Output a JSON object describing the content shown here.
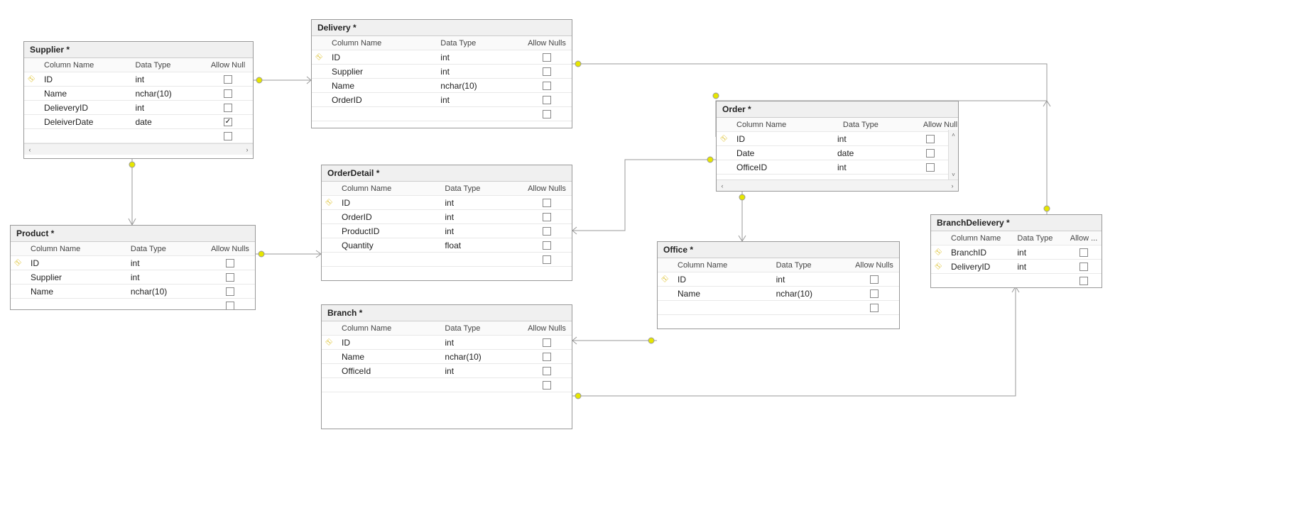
{
  "headers": {
    "colname": "Column Name",
    "datatype": "Data Type",
    "allownulls": "Allow Nulls",
    "allownull": "Allow Null",
    "allowdots": "Allow ..."
  },
  "tables": {
    "supplier": {
      "title": "Supplier *",
      "cols": [
        {
          "name": "ID",
          "type": "int",
          "key": true,
          "null": false
        },
        {
          "name": "Name",
          "type": "nchar(10)",
          "key": false,
          "null": false
        },
        {
          "name": "DelieveryID",
          "type": "int",
          "key": false,
          "null": false
        },
        {
          "name": "DeleiverDate",
          "type": "date",
          "key": false,
          "null": true
        }
      ]
    },
    "delivery": {
      "title": "Delivery *",
      "cols": [
        {
          "name": "ID",
          "type": "int",
          "key": true,
          "null": false
        },
        {
          "name": "Supplier",
          "type": "int",
          "key": false,
          "null": false
        },
        {
          "name": "Name",
          "type": "nchar(10)",
          "key": false,
          "null": false
        },
        {
          "name": "OrderID",
          "type": "int",
          "key": false,
          "null": false
        }
      ]
    },
    "product": {
      "title": "Product *",
      "cols": [
        {
          "name": "ID",
          "type": "int",
          "key": true,
          "null": false
        },
        {
          "name": "Supplier",
          "type": "int",
          "key": false,
          "null": false
        },
        {
          "name": "Name",
          "type": "nchar(10)",
          "key": false,
          "null": false
        }
      ]
    },
    "orderdetail": {
      "title": "OrderDetail *",
      "cols": [
        {
          "name": "ID",
          "type": "int",
          "key": true,
          "null": false
        },
        {
          "name": "OrderID",
          "type": "int",
          "key": false,
          "null": false
        },
        {
          "name": "ProductID",
          "type": "int",
          "key": false,
          "null": false
        },
        {
          "name": "Quantity",
          "type": "float",
          "key": false,
          "null": false
        }
      ]
    },
    "order": {
      "title": "Order *",
      "cols": [
        {
          "name": "ID",
          "type": "int",
          "key": true,
          "null": false
        },
        {
          "name": "Date",
          "type": "date",
          "key": false,
          "null": false
        },
        {
          "name": "OfficeID",
          "type": "int",
          "key": false,
          "null": false
        }
      ]
    },
    "office": {
      "title": "Office *",
      "cols": [
        {
          "name": "ID",
          "type": "int",
          "key": true,
          "null": false
        },
        {
          "name": "Name",
          "type": "nchar(10)",
          "key": false,
          "null": false
        }
      ]
    },
    "branch": {
      "title": "Branch *",
      "cols": [
        {
          "name": "ID",
          "type": "int",
          "key": true,
          "null": false
        },
        {
          "name": "Name",
          "type": "nchar(10)",
          "key": false,
          "null": false
        },
        {
          "name": "OfficeId",
          "type": "int",
          "key": false,
          "null": false
        }
      ]
    },
    "branchdelievery": {
      "title": "BranchDelievery *",
      "cols": [
        {
          "name": "BranchID",
          "type": "int",
          "key": true,
          "null": false
        },
        {
          "name": "DeliveryID",
          "type": "int",
          "key": true,
          "null": false
        }
      ]
    }
  },
  "relationships": [
    {
      "from": "Supplier",
      "to": "Delivery"
    },
    {
      "from": "Supplier",
      "to": "Product"
    },
    {
      "from": "Product",
      "to": "OrderDetail"
    },
    {
      "from": "Delivery",
      "to": "Order"
    },
    {
      "from": "OrderDetail",
      "to": "Order"
    },
    {
      "from": "Order",
      "to": "Office"
    },
    {
      "from": "Branch",
      "to": "Office"
    },
    {
      "from": "Branch",
      "to": "BranchDelievery"
    },
    {
      "from": "Delivery",
      "to": "BranchDelievery"
    }
  ]
}
